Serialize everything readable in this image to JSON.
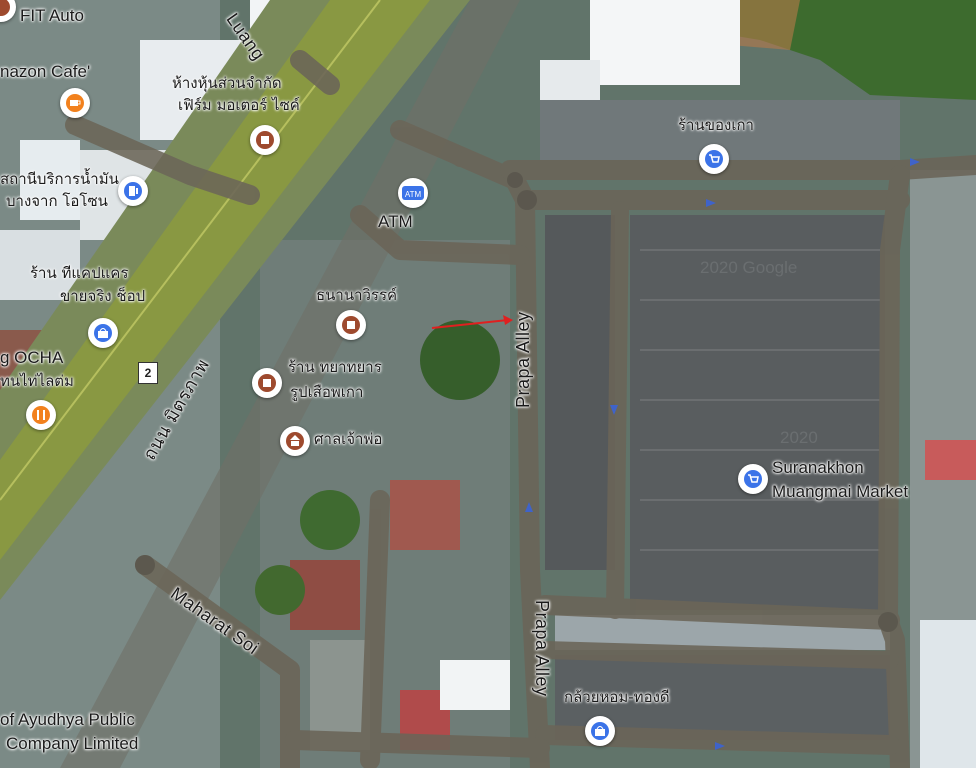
{
  "labels": {
    "fit_auto": "FIT Auto",
    "amazon_cafe": "nazon Cafe'",
    "th_top_shop_1": "ห้างหุ้นส่วนจำกัด",
    "th_top_shop_2": "เฟิร์ม มอเตอร์ ไซค์",
    "th_gas_1": "สถานีบริการน้ำมัน",
    "th_gas_2": "บางจาก โอโซน",
    "th_store_1": "ร้าน ทีแคปแคร",
    "th_store_2": "ขายจริง ช็อป",
    "ocha_1": "g OCHA",
    "ocha_2": "ทนไท่ไลต่ม",
    "luang_road": "Luang",
    "atm": "ATM",
    "th_pharmacy": "ธนานาวิรรค์",
    "th_shop_2a": "ร้าน ทยาทยาร",
    "th_shop_2b": "รูปเสือพเกา",
    "th_shrine": "ศาลเจ้าพ่อ",
    "th_main_road": "ถนน มิตรภาพ",
    "route_shield": "2",
    "th_market_top": "ร้านของเกา",
    "prapa_alley_1": "Prapa Alley",
    "prapa_alley_2": "Prapa Alley",
    "market_line1": "Suranakhon",
    "market_line2": "Muangmai Market",
    "maharat_soi": "Maharat Soi",
    "bank_line1": "of Ayudhya Public",
    "bank_line2": "Company Limited",
    "th_bottom_shop": "กล้วยหอม-ทองดี",
    "watermark_1": "2020 Google",
    "watermark_2": "2020",
    "atm_icon_text": "ATM"
  },
  "colors": {
    "road": "#6b6558",
    "road_highway_center": "#8c9a3e",
    "arrow": "#e02020",
    "pin_blue": "#3b73e8",
    "pin_orange": "#f2811d",
    "pin_brown": "#9e4a2e"
  },
  "icons": [
    "cafe-icon",
    "shop-icon",
    "gas-station-icon",
    "shopping-bag-icon",
    "restaurant-icon",
    "atm-icon",
    "cart-icon",
    "shrine-icon"
  ]
}
